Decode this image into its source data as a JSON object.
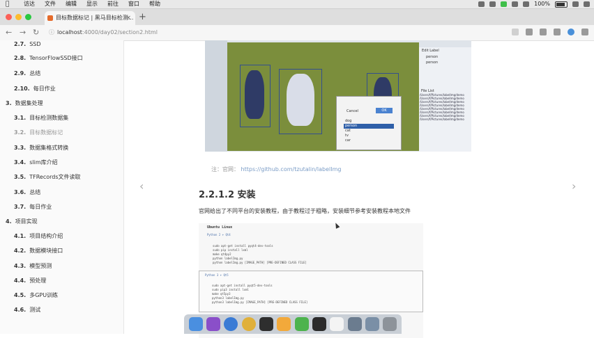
{
  "menubar": {
    "menus": [
      "访达",
      "文件",
      "编辑",
      "显示",
      "前往",
      "窗口",
      "帮助"
    ],
    "battery": "100%"
  },
  "tab": {
    "title": "目标数据标记 | 黑马目标检测..."
  },
  "address": {
    "host": "localhost",
    "path": ":4000/day02/section2.html"
  },
  "sidebar": {
    "items": [
      {
        "num": "2.7.",
        "label": "SSD"
      },
      {
        "num": "2.8.",
        "label": "TensorFlowSSD接口"
      },
      {
        "num": "2.9.",
        "label": "总结"
      },
      {
        "num": "2.10.",
        "label": "每日作业"
      },
      {
        "num": "3.",
        "label": "数据集处理"
      },
      {
        "num": "3.1.",
        "label": "目标检测数据集"
      },
      {
        "num": "3.2.",
        "label": "目标数据标记"
      },
      {
        "num": "3.3.",
        "label": "数据集格式转换"
      },
      {
        "num": "3.4.",
        "label": "slim库介绍"
      },
      {
        "num": "3.5.",
        "label": "TFRecords文件读取"
      },
      {
        "num": "3.6.",
        "label": "总结"
      },
      {
        "num": "3.7.",
        "label": "每日作业"
      },
      {
        "num": "4.",
        "label": "项目实现"
      },
      {
        "num": "4.1.",
        "label": "项目结构介绍"
      },
      {
        "num": "4.2.",
        "label": "数据模块接口"
      },
      {
        "num": "4.3.",
        "label": "模型预测"
      },
      {
        "num": "4.4.",
        "label": "预处理"
      },
      {
        "num": "4.5.",
        "label": "多GPU训练"
      },
      {
        "num": "4.6.",
        "label": "测试"
      }
    ]
  },
  "screenshot": {
    "dialog_buttons": [
      "Cancel",
      "OK"
    ],
    "dialog_list": [
      "dog",
      "person",
      "cat",
      "tv",
      "car"
    ],
    "label_list": [
      "person",
      "person"
    ],
    "panel_title": "Edit Label",
    "file_list_title": "File List"
  },
  "content": {
    "note_prefix": "注：官网：",
    "note_link": "https://github.com/tzutalin/labelImg",
    "heading": "2.2.1.2 安装",
    "paragraph": "官网给出了不同平台的安装教程，由于教程过于粗略，安装细节参考安装教程本地文件",
    "code": {
      "title": "Ubuntu Linux",
      "py2_label": "Python 2 + Qt4",
      "py2_lines": "sudo apt-get install pyqt4-dev-tools\nsudo pip install lxml\nmake qt4py2\npython labelImg.py\npython labelImg.py [IMAGE_PATH] [PRE-DEFINED CLASS FILE]",
      "py3_label": "Python 3 + Qt5",
      "py3_lines": "sudo apt-get install pyqt5-dev-tools\nsudo pip3 install lxml\nmake qt5py3\npython3 labelImg.py\npython3 labelImg.py [IMAGE_PATH] [PRE-DEFINED CLASS FILE]"
    }
  },
  "colors": {
    "field": "#7b8e3c",
    "box": "#334f8f",
    "link": "#7a9cc6"
  }
}
